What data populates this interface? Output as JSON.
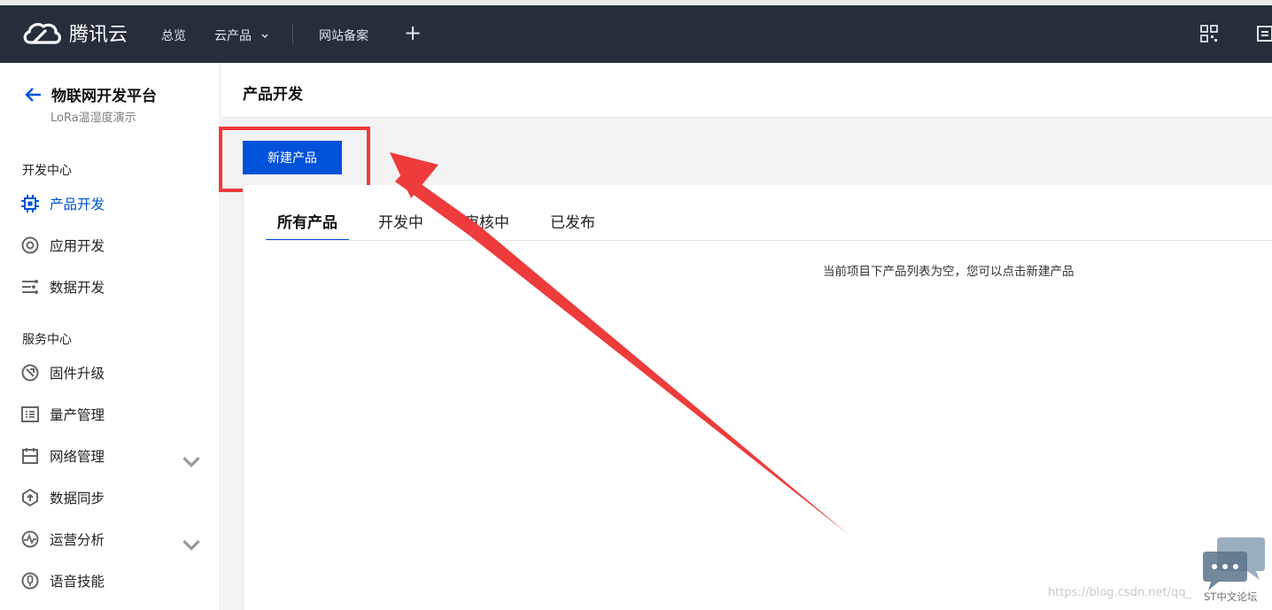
{
  "topbar": {
    "brand": "腾讯云",
    "nav": [
      "总览",
      "云产品",
      "网站备案"
    ],
    "plus": "+"
  },
  "sidebar": {
    "app_title": "物联网开发平台",
    "app_subtitle": "LoRa温湿度演示",
    "sections": [
      {
        "title": "开发中心",
        "items": [
          {
            "label": "产品开发",
            "icon": "chip-icon",
            "active": true
          },
          {
            "label": "应用开发",
            "icon": "app-dev-icon"
          },
          {
            "label": "数据开发",
            "icon": "data-dev-icon"
          }
        ]
      },
      {
        "title": "服务中心",
        "items": [
          {
            "label": "固件升级",
            "icon": "firmware-icon"
          },
          {
            "label": "量产管理",
            "icon": "list-icon"
          },
          {
            "label": "网络管理",
            "icon": "network-icon",
            "expandable": true
          },
          {
            "label": "数据同步",
            "icon": "sync-icon"
          },
          {
            "label": "运营分析",
            "icon": "analytics-icon",
            "expandable": true
          },
          {
            "label": "语音技能",
            "icon": "mic-icon"
          }
        ]
      }
    ]
  },
  "main": {
    "page_title": "产品开发",
    "new_button": "新建产品",
    "tabs": [
      "所有产品",
      "开发中",
      "审核中",
      "已发布"
    ],
    "active_tab": "所有产品",
    "empty_message": "当前项目下产品列表为空，您可以点击新建产品"
  },
  "watermark": {
    "url": "https://blog.csdn.net/qq_",
    "forum": "ST中文论坛"
  },
  "colors": {
    "topbar_bg": "#262e3c",
    "primary": "#0052d9",
    "annotation_red": "#ee3b3b"
  }
}
